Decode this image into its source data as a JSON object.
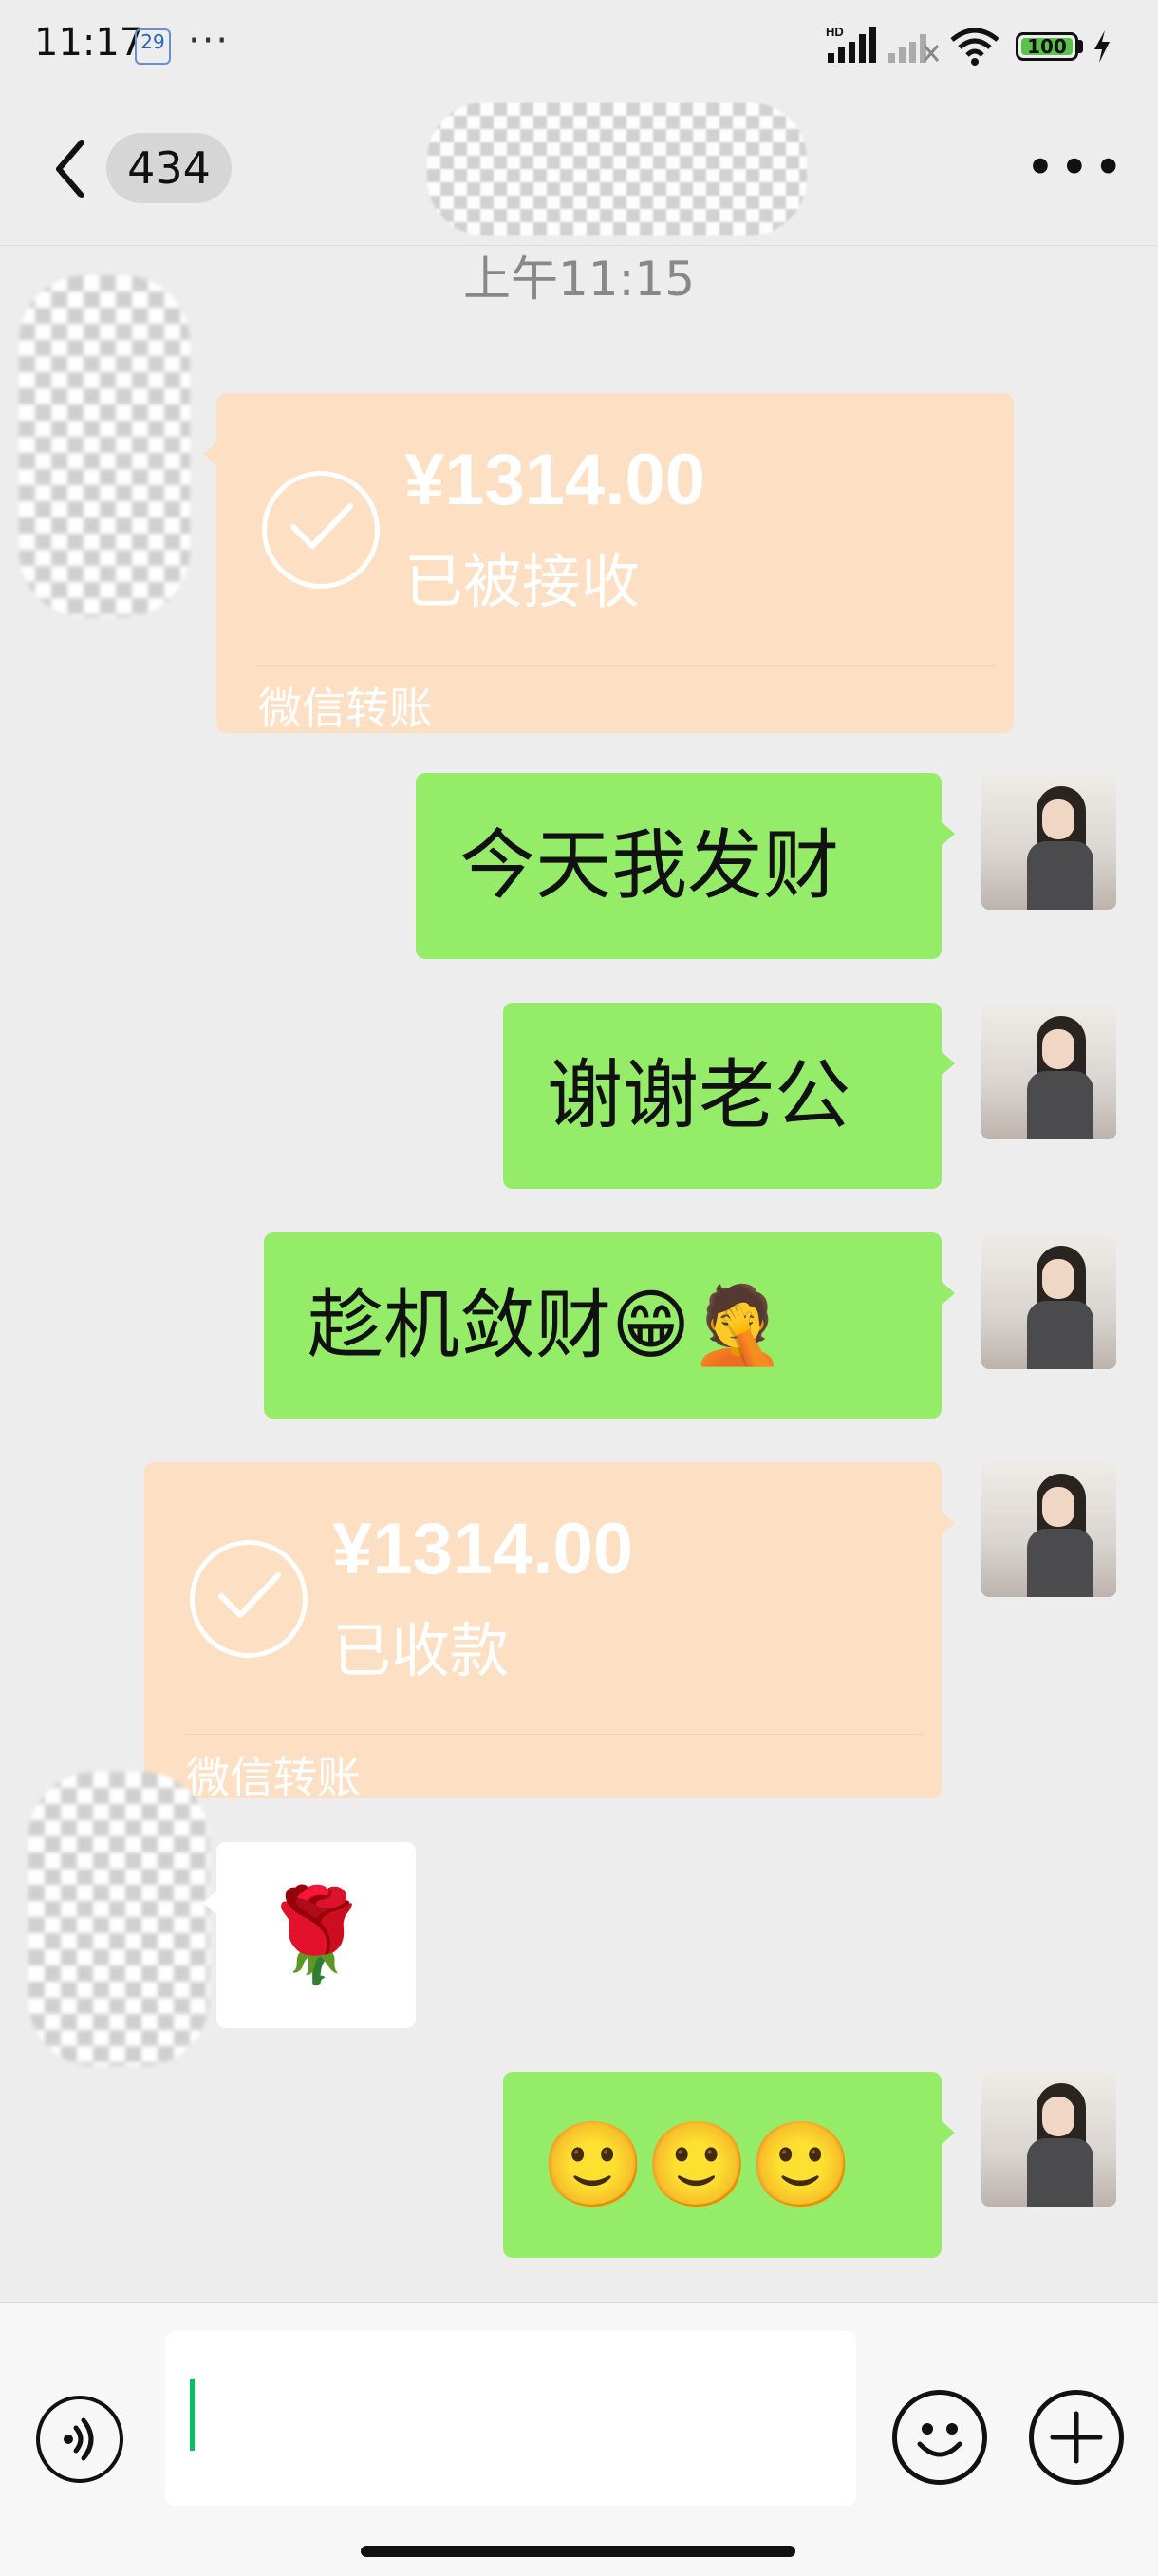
{
  "status_bar": {
    "time": "11:17",
    "calendar_day": "29",
    "battery": "100",
    "network_label": "HD"
  },
  "header": {
    "unread_count": "434"
  },
  "chat": {
    "timestamp": "上午11:15",
    "messages": [
      {
        "type": "transfer",
        "side": "left",
        "amount": "¥1314.00",
        "status": "已被接收",
        "label": "微信转账"
      },
      {
        "type": "text",
        "side": "right",
        "text": "今天我发财"
      },
      {
        "type": "text",
        "side": "right",
        "text": "谢谢老公"
      },
      {
        "type": "text",
        "side": "right",
        "text": "趁机敛财😁🤦"
      },
      {
        "type": "transfer",
        "side": "right",
        "amount": "¥1314.00",
        "status": "已收款",
        "label": "微信转账"
      },
      {
        "type": "sticker",
        "side": "left",
        "text": "🌹"
      },
      {
        "type": "text",
        "side": "right",
        "text": "🙂🙂🙂"
      }
    ]
  },
  "colors": {
    "green_bubble": "#95ec69",
    "transfer_bubble": "#fde0c3",
    "background": "#ededed",
    "caret": "#07c160"
  }
}
